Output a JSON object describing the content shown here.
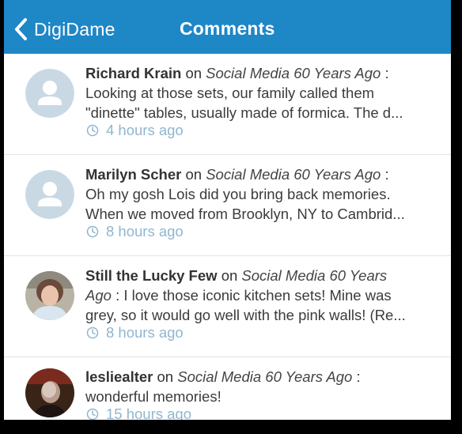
{
  "navbar": {
    "back_label": "DigiDame",
    "title": "Comments"
  },
  "comments": [
    {
      "author": "Richard Krain",
      "on_word": "on",
      "post": "Social Media 60 Years Ago",
      "separator": ":",
      "line1": "Looking at those sets, our family called them",
      "line2": "\"dinette\" tables, usually made of formica. The d...",
      "time": "4 hours ago",
      "avatar": "default-avatar-icon"
    },
    {
      "author": "Marilyn Scher",
      "on_word": "on",
      "post": "Social Media 60 Years Ago",
      "separator": ":",
      "line1": "Oh my gosh Lois did you bring back memories.",
      "line2": "When we moved from Brooklyn, NY to Cambrid...",
      "time": "8 hours ago",
      "avatar": "default-avatar-icon"
    },
    {
      "author": "Still the Lucky Few",
      "on_word": "on",
      "post_part1": "Social Media 60 Years",
      "post_part2": "Ago",
      "separator": ":",
      "line1_rest": "I love those iconic kitchen sets! Mine was",
      "line2": "grey, so it would go well with the pink walls! (Re...",
      "time": "8 hours ago",
      "avatar": "user-photo"
    },
    {
      "author": "lesliealter",
      "on_word": "on",
      "post": "Social Media 60 Years Ago",
      "separator": ":",
      "line1": "wonderful memories!",
      "time": "15 hours ago",
      "avatar": "user-photo"
    }
  ],
  "colors": {
    "navbar": "#1e87c6",
    "timestamp": "#8fb6cf",
    "avatar_placeholder": "#c9d9e4"
  }
}
